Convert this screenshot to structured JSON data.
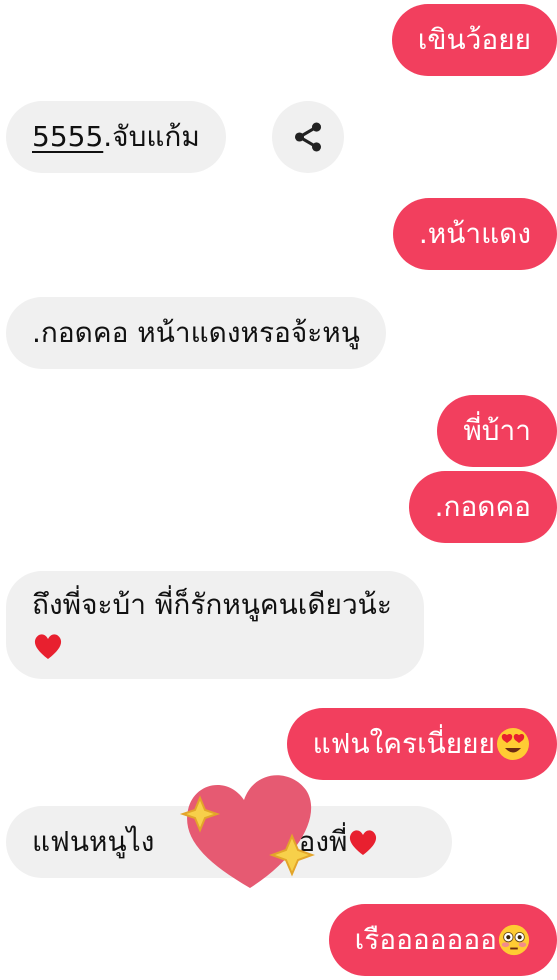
{
  "messages": [
    {
      "text": "เขินว้อยย"
    },
    {
      "number": "5555",
      "text": " .จับแก้ม"
    },
    {
      "text": ".หน้าแดง"
    },
    {
      "text": ".กอดคอ หน้าแดงหรอจ้ะหนู"
    },
    {
      "text": "พี่บ้าา"
    },
    {
      "text": ".กอดคอ"
    },
    {
      "text": "ถึงพี่จะบ้า พี่ก็รักหนูคนเดียวน้ะ"
    },
    {
      "text": "แฟนใครเนี่ยยย"
    },
    {
      "text": "แฟนหนูไง",
      "text_end": "ของพี่"
    },
    {
      "text": "เรือออออออ"
    }
  ],
  "icons": {
    "share": "share-icon",
    "heart": "red-heart-emoji",
    "heart_eyes": "heart-eyes-emoji",
    "flushed": "flushed-face-emoji",
    "sticker": "heart-sparkle-sticker"
  },
  "colors": {
    "outgoing_bubble": "#f23f5e",
    "incoming_bubble": "#f0f0f0",
    "background": "#ffffff"
  }
}
